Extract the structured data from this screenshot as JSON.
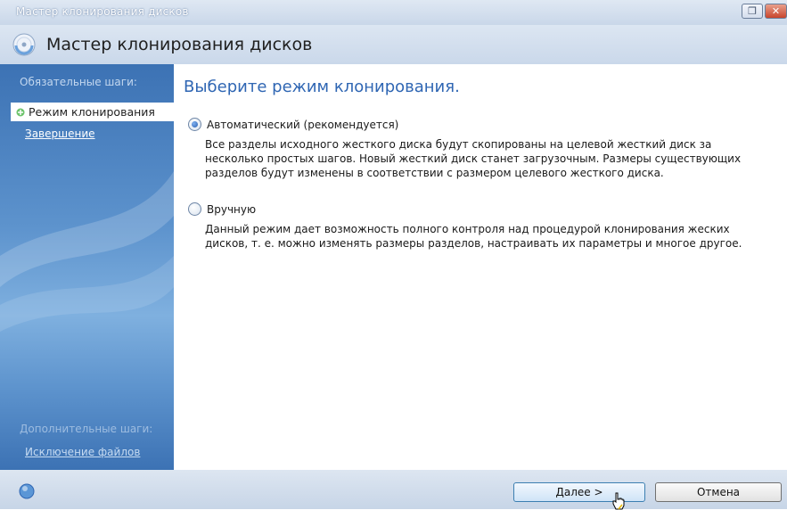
{
  "window": {
    "titlebar_text": "Мастер клонирования дисков",
    "restore_glyph": "❐",
    "close_glyph": "✕"
  },
  "header": {
    "title": "Мастер клонирования дисков"
  },
  "sidebar": {
    "required_section_label": "Обязательные шаги:",
    "active_step": "Режим клонирования",
    "finish_link": "Завершение",
    "optional_section_label": "Дополнительные шаги:",
    "exclude_link": "Исключение файлов"
  },
  "main": {
    "heading": "Выберите режим клонирования.",
    "options": [
      {
        "label": "Автоматический (рекомендуется)",
        "selected": true,
        "description": "Все разделы исходного жесткого диска будут скопированы на целевой жесткий диск за несколько простых шагов. Новый жесткий диск станет загрузочным. Размеры существующих разделов будут изменены в соответствии с размером целевого жесткого диска."
      },
      {
        "label": "Вручную",
        "selected": false,
        "description": "Данный режим дает возможность полного контроля над процедурой клонирования жеских дисков, т. е. можно изменять размеры разделов, настраивать их параметры и многое другое."
      }
    ]
  },
  "footer": {
    "next_label": "Далее >",
    "cancel_label": "Отмена"
  },
  "colors": {
    "heading_blue": "#2f66b3",
    "sidebar_blue": "#3c72b4"
  }
}
